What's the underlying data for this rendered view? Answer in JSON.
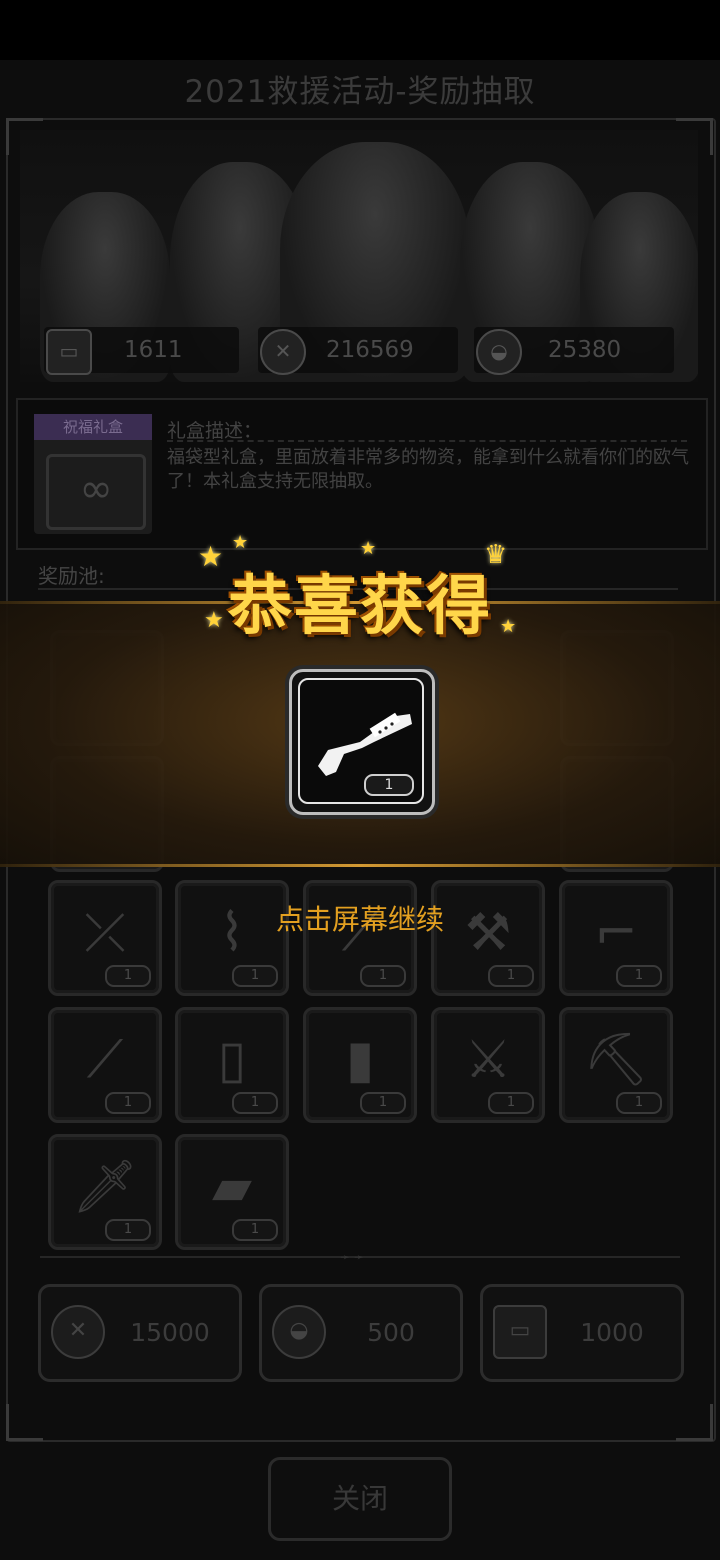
{
  "title": "2021救援活动-奖励抽取",
  "stats": [
    {
      "icon": "ticket-card-icon",
      "value": "1611"
    },
    {
      "icon": "crossed-weapons-medal-icon",
      "value": "216569"
    },
    {
      "icon": "vehicle-medal-icon",
      "value": "25380"
    }
  ],
  "gift": {
    "ribbon": "祝福礼盒",
    "desc_title": "礼盒描述：",
    "desc_text": "福袋型礼盒，里面放着非常多的物资，能拿到什么就看你们的欧气了！本礼盒支持无限抽取。"
  },
  "pool_label": "奖励池:",
  "pool_items": [
    {
      "icon": "crossbow-icon",
      "qty": "1"
    },
    {
      "icon": "compound-bow-icon",
      "qty": "1"
    },
    {
      "icon": "machete-icon",
      "qty": "1"
    },
    {
      "icon": "fire-axe-icon",
      "qty": "1"
    },
    {
      "icon": "desert-eagle-pistol-icon",
      "qty": "1"
    },
    {
      "icon": "katana-icon",
      "qty": "1"
    },
    {
      "icon": "wooden-shield-icon",
      "qty": "1"
    },
    {
      "icon": "flamethrower-icon",
      "qty": "1"
    },
    {
      "icon": "tomahawk-icon",
      "qty": "1"
    },
    {
      "icon": "pickaxe-icon",
      "qty": "1"
    },
    {
      "icon": "knuckle-knife-icon",
      "qty": "1"
    },
    {
      "icon": "cleaver-icon",
      "qty": "1"
    }
  ],
  "costs": [
    {
      "icon": "crossed-weapons-medal-icon",
      "value": "15000"
    },
    {
      "icon": "vehicle-medal-icon",
      "value": "500"
    },
    {
      "icon": "ticket-card-icon",
      "value": "1000"
    }
  ],
  "close_label": "关闭",
  "overlay": {
    "congrats": "恭喜获得",
    "reward_icon": "shotgun-icon",
    "reward_qty": "1",
    "tap_continue": "点击屏幕继续"
  }
}
